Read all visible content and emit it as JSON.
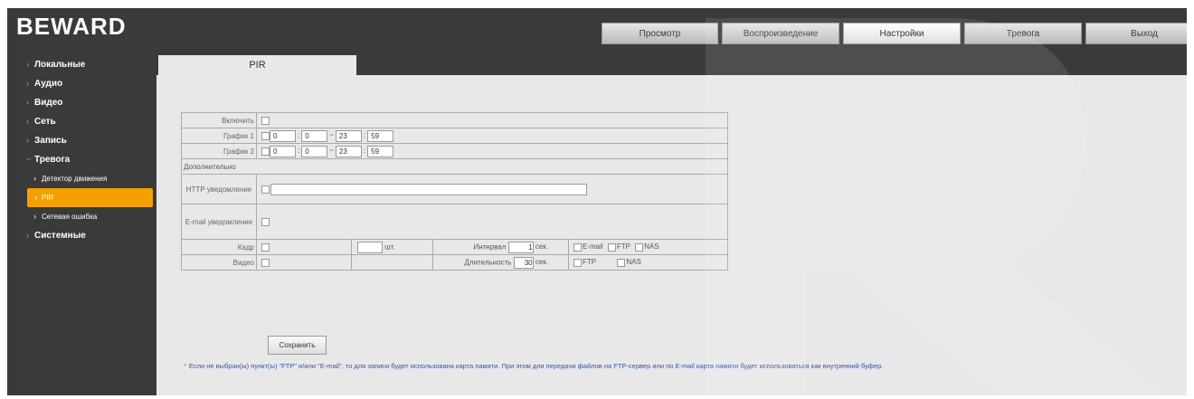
{
  "brand": {
    "logo_text": "BEWARD"
  },
  "nav": {
    "tabs": [
      {
        "label": "Просмотр"
      },
      {
        "label": "Воспроизведение"
      },
      {
        "label": "Настройки",
        "active": true
      },
      {
        "label": "Тревога"
      },
      {
        "label": "Выход"
      }
    ]
  },
  "sidebar": {
    "items": [
      {
        "label": "Локальные"
      },
      {
        "label": "Аудио"
      },
      {
        "label": "Видео"
      },
      {
        "label": "Сеть"
      },
      {
        "label": "Запись"
      },
      {
        "label": "Тревога"
      },
      {
        "label": "Детектор движения"
      },
      {
        "label": "PIR",
        "active": true
      },
      {
        "label": "Сетевая ошибка"
      },
      {
        "label": "Системные"
      }
    ]
  },
  "page": {
    "tab_label": "PIR"
  },
  "form": {
    "enable_label": "Включить",
    "schedule1": {
      "label": "График 1",
      "start_h": "0",
      "start_m": "0",
      "end_h": "23",
      "end_m": "59"
    },
    "schedule2": {
      "label": "График 2",
      "start_h": "0",
      "start_m": "0",
      "end_h": "23",
      "end_m": "59"
    },
    "additional_label": "Дополнительно",
    "http_label": "HTTP уведомление",
    "email_label": "E-mail уведомление",
    "frame": {
      "label": "Кадр",
      "count_unit": "шт.",
      "interval_label": "Интервал",
      "interval_value": "1",
      "interval_unit": "сек.",
      "opt_email": "E-mail",
      "opt_ftp": "FTP",
      "opt_nas": "NAS"
    },
    "video": {
      "label": "Видео",
      "duration_label": "Длительность",
      "duration_value": "30",
      "duration_unit": "сек.",
      "opt_ftp": "FTP",
      "opt_nas": "NAS"
    },
    "save_label": "Сохранить",
    "note": "Если не выбран(ы) пункт(ы) \"FTP\" и/или \"E-mail\", то для записи будет использована карта памяти. При этом для передачи файлов на FTP-сервер или по E-mail карта памяти будет использоваться как внутренний буфер."
  },
  "colors": {
    "accent": "#f4a100",
    "frame_bg": "#3a3a3a",
    "panel_bg": "#e8e8e8"
  }
}
